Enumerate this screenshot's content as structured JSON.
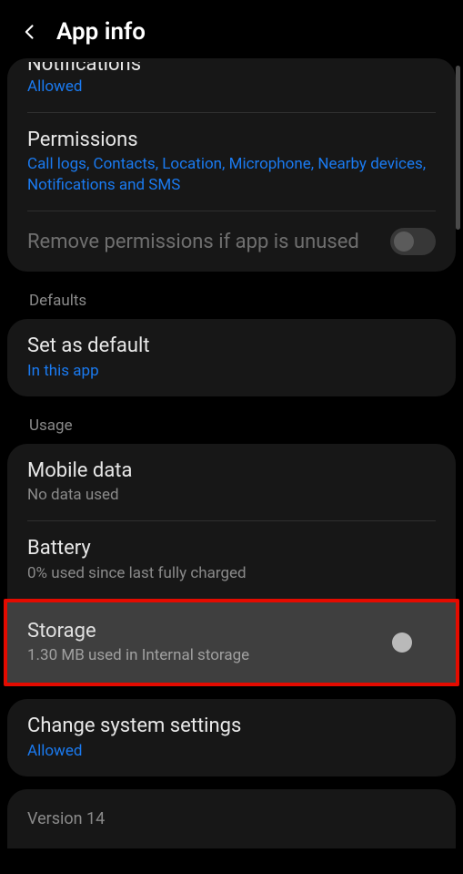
{
  "header": {
    "title": "App info"
  },
  "notifications": {
    "title": "Notifications",
    "status": "Allowed"
  },
  "permissions": {
    "title": "Permissions",
    "summary": "Call logs, Contacts, Location, Microphone, Nearby devices, Notifications and SMS"
  },
  "removeUnused": {
    "title": "Remove permissions if app is unused",
    "enabled": false
  },
  "sections": {
    "defaults": "Defaults",
    "usage": "Usage"
  },
  "setDefault": {
    "title": "Set as default",
    "summary": "In this app"
  },
  "mobileData": {
    "title": "Mobile data",
    "summary": "No data used"
  },
  "battery": {
    "title": "Battery",
    "summary": "0% used since last fully charged"
  },
  "storage": {
    "title": "Storage",
    "summary": "1.30 MB used in Internal storage"
  },
  "changeSystem": {
    "title": "Change system settings",
    "status": "Allowed"
  },
  "version": {
    "text": "Version 14"
  }
}
